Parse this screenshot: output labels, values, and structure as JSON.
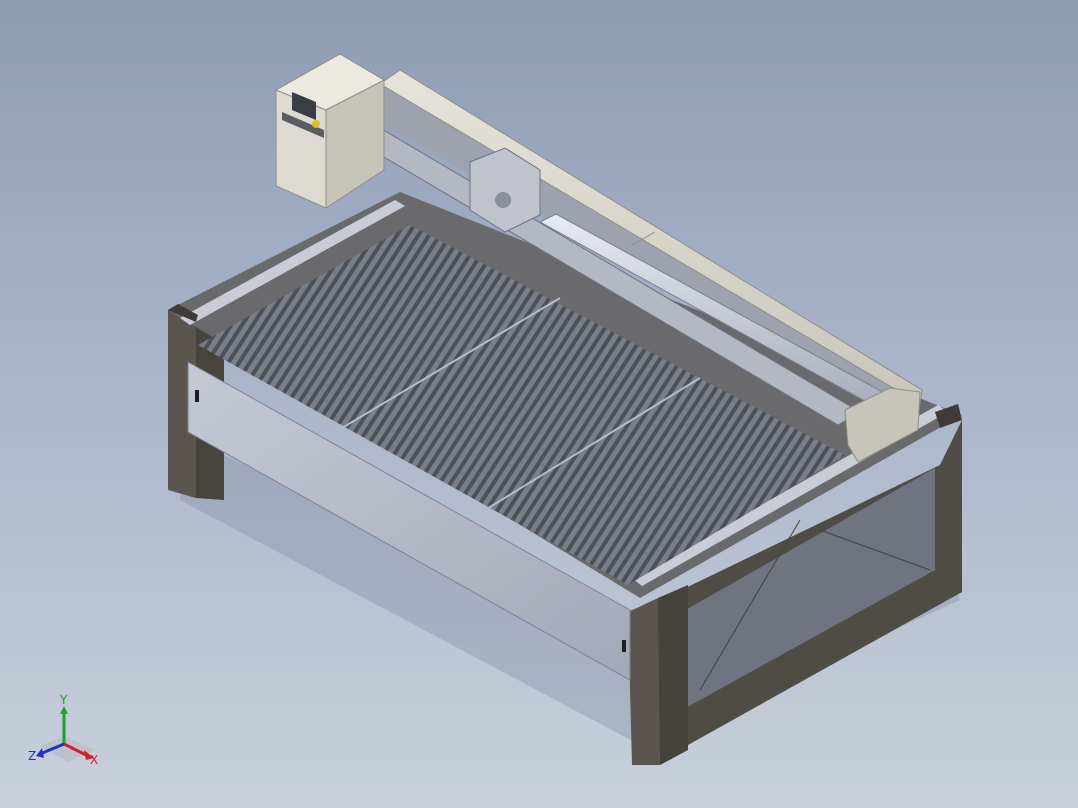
{
  "viewport": {
    "background_top": "#8e9cb4",
    "background_bottom": "#c9d0dc"
  },
  "model": {
    "description_icon": "laser-cutting-machine-model",
    "frame_color": "#5f5a52",
    "bed_color": "#6b6f78",
    "panel_color": "#b7bccb",
    "housing_color": "#d8d6cc"
  },
  "triad": {
    "x_label": "X",
    "y_label": "Y",
    "z_label": "Z",
    "x_color": "#d42020",
    "y_color": "#1fa21f",
    "z_color": "#2030d0"
  }
}
